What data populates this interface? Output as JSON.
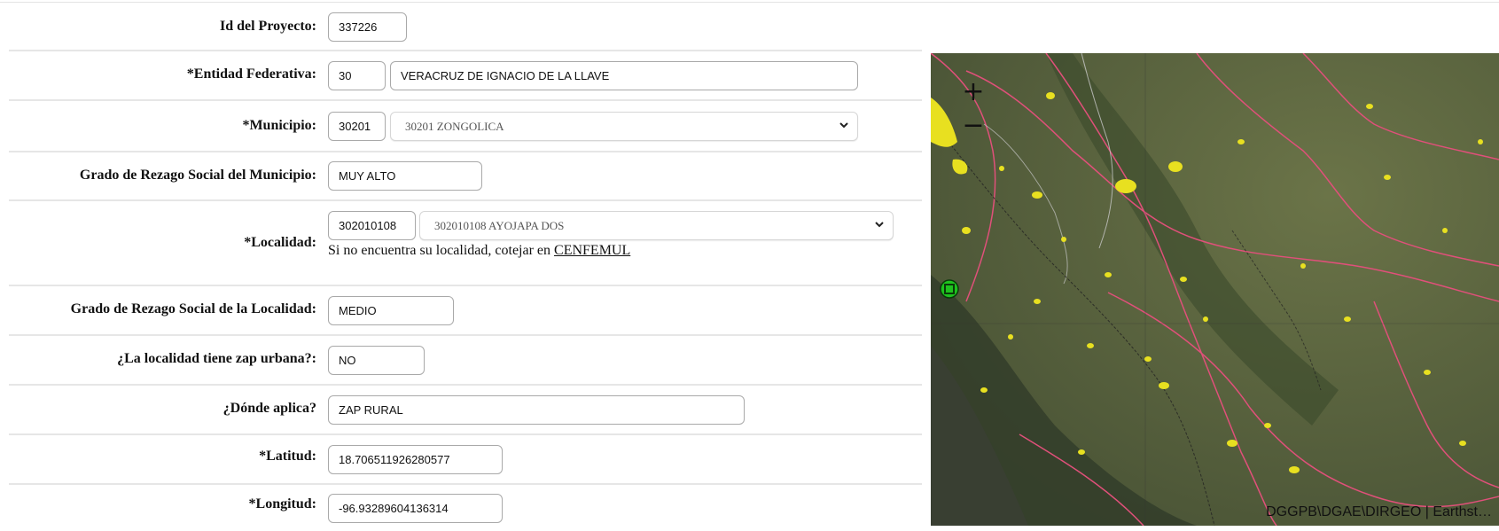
{
  "form": {
    "id_proyecto": {
      "label": "Id del Proyecto:",
      "value": "337226"
    },
    "entidad": {
      "label": "*Entidad Federativa:",
      "code": "30",
      "name": "VERACRUZ DE IGNACIO DE LA LLAVE"
    },
    "municipio": {
      "label": "*Municipio:",
      "code": "30201",
      "selected": "30201 ZONGOLICA"
    },
    "rezago_municipio": {
      "label": "Grado de Rezago Social del Municipio:",
      "value": "MUY ALTO"
    },
    "localidad": {
      "label": "*Localidad:",
      "code": "302010108",
      "selected": "302010108 AYOJAPA DOS",
      "note": "Si no encuentra su localidad, cotejar en",
      "link": "CENFEMUL"
    },
    "rezago_localidad": {
      "label": "Grado de Rezago Social de la Localidad:",
      "value": "MEDIO"
    },
    "zap_urbana": {
      "label": "¿La localidad tiene zap urbana?:",
      "value": "NO"
    },
    "donde_aplica": {
      "label": "¿Dónde aplica?",
      "value": "ZAP RURAL"
    },
    "latitud": {
      "label": "*Latitud:",
      "value": "18.706511926280577"
    },
    "longitud": {
      "label": "*Longitud:",
      "value": "-96.93289604136314"
    }
  },
  "map": {
    "zoom_in": "+",
    "zoom_out": "−",
    "attribution": "DGGPB\\DGAE\\DIRGEO | Earthst…",
    "marker_color": "#1ec21e",
    "boundary_color": "#e0507a",
    "settlement_color": "#e8e020"
  }
}
